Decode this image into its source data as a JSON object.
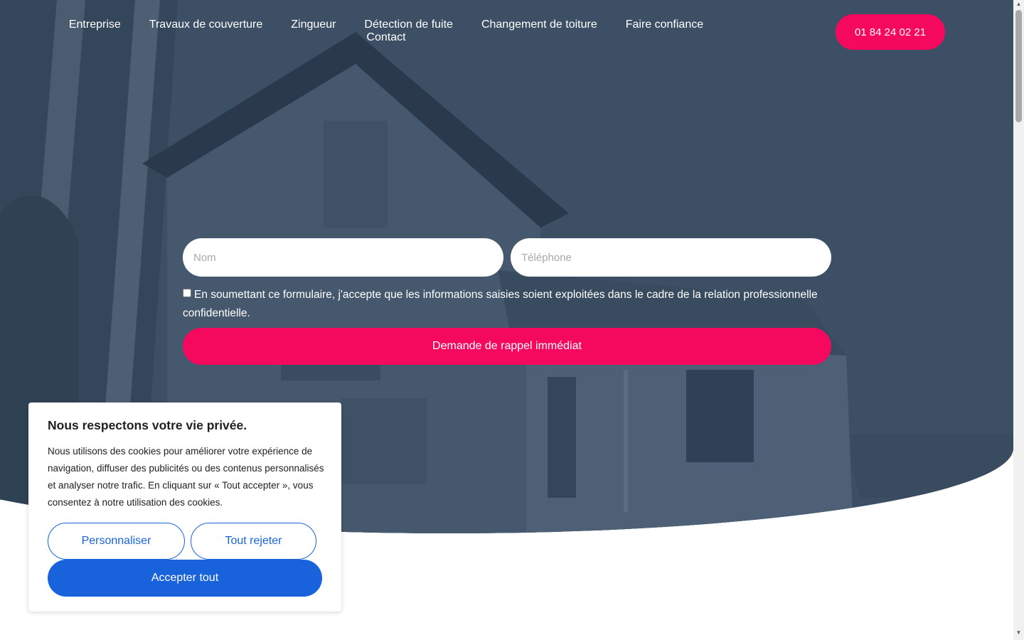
{
  "nav": {
    "items": [
      {
        "label": "Entreprise"
      },
      {
        "label": "Travaux de couverture"
      },
      {
        "label": "Zingueur"
      },
      {
        "label": "Détection de fuite"
      },
      {
        "label": "Changement de toiture"
      },
      {
        "label": "Faire confiance"
      },
      {
        "label": "Contact"
      }
    ],
    "phone": "01 84 24 02 21"
  },
  "form": {
    "name_placeholder": "Nom",
    "phone_placeholder": "Téléphone",
    "consent_text": "En soumettant ce formulaire, j'accepte que les informations saisies soient exploitées dans le cadre de la relation professionnelle confidentielle.",
    "submit_label": "Demande de rappel immédiat"
  },
  "cookie": {
    "title": "Nous respectons votre vie privée.",
    "text": "Nous utilisons des cookies pour améliorer votre expérience de navigation, diffuser des publicités ou des contenus personnalisés et analyser notre trafic. En cliquant sur « Tout accepter », vous consentez à notre utilisation des cookies.",
    "customize_label": "Personnaliser",
    "reject_label": "Tout rejeter",
    "accept_label": "Accepter tout"
  },
  "colors": {
    "accent_pink": "#f5095f",
    "cookie_blue": "#1863dc",
    "hero_overlay": "#3b4d62"
  }
}
